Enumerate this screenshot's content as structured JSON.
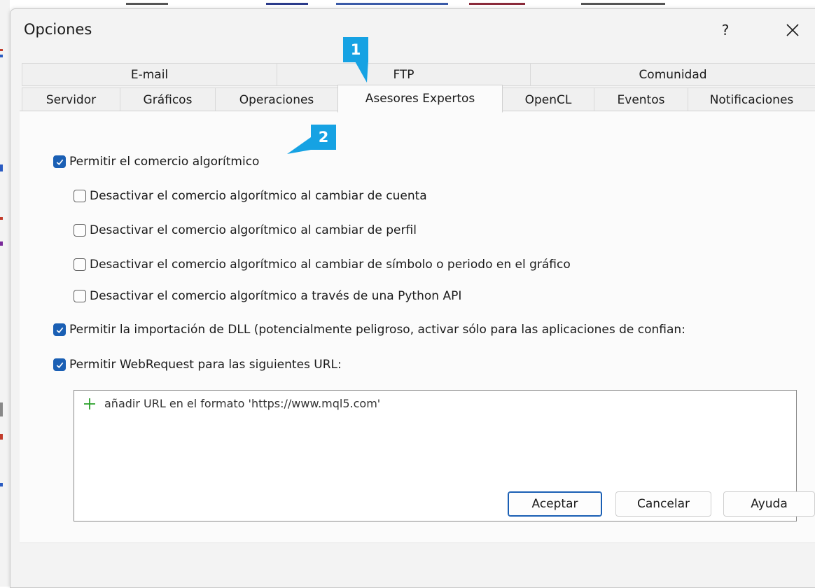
{
  "dialog": {
    "title": "Opciones",
    "help_label": "?"
  },
  "tabs_top": [
    {
      "label": "E-mail"
    },
    {
      "label": "FTP"
    },
    {
      "label": "Comunidad"
    }
  ],
  "tabs_bottom": [
    {
      "label": "Servidor"
    },
    {
      "label": "Gráficos"
    },
    {
      "label": "Operaciones"
    },
    {
      "label": "Asesores Expertos",
      "active": true
    },
    {
      "label": "OpenCL"
    },
    {
      "label": "Eventos"
    },
    {
      "label": "Notificaciones"
    }
  ],
  "options": [
    {
      "label": "Permitir el comercio algorítmico",
      "checked": true
    },
    {
      "label": "Desactivar el comercio algorítmico al cambiar de cuenta",
      "checked": false
    },
    {
      "label": "Desactivar el comercio algorítmico al cambiar de perfil",
      "checked": false
    },
    {
      "label": "Desactivar el comercio algorítmico al cambiar de símbolo o periodo en el gráfico",
      "checked": false
    },
    {
      "label": "Desactivar el comercio algorítmico a través de una Python API",
      "checked": false
    },
    {
      "label": "Permitir la importación de DLL (potencialmente peligroso, activar sólo para las aplicaciones de confian:",
      "checked": true
    },
    {
      "label": "Permitir WebRequest para las siguientes URL:",
      "checked": true
    }
  ],
  "url_list": {
    "add_hint": "añadir URL en el formato 'https://www.mql5.com'"
  },
  "buttons": {
    "ok": "Aceptar",
    "cancel": "Cancelar",
    "help": "Ayuda"
  },
  "callouts": {
    "one": "1",
    "two": "2"
  },
  "colors": {
    "accent": "#1a5fb4",
    "callout": "#16a2e3",
    "plus": "#2aa02a"
  }
}
